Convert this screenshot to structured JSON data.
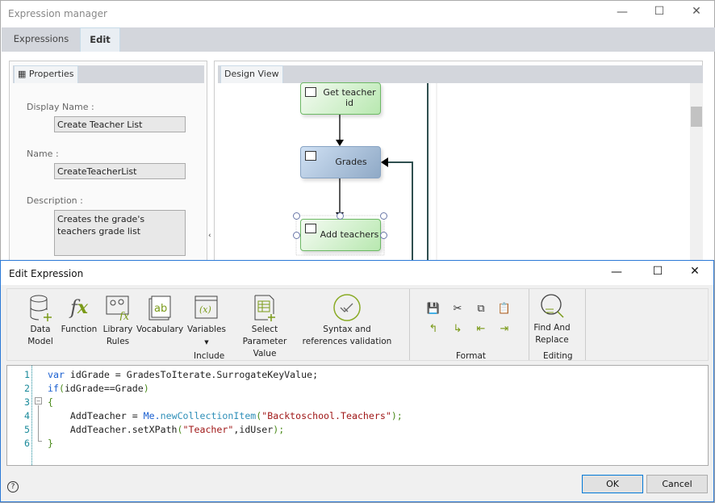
{
  "window": {
    "title": "Expression manager",
    "controls": [
      "minimize",
      "maximize",
      "close"
    ]
  },
  "tabs": [
    {
      "label": "Expressions",
      "active": false
    },
    {
      "label": "Edit",
      "active": true
    }
  ],
  "properties": {
    "tab": "Properties",
    "display_name_label": "Display Name :",
    "display_name": "Create Teacher List",
    "name_label": "Name :",
    "name": "CreateTeacherList",
    "description_label": "Description :",
    "description": "Creates the grade's teachers grade list"
  },
  "design": {
    "tab": "Design View",
    "nodes": [
      {
        "label": "Get teacher id",
        "type": "task",
        "color": "#b8e8b0"
      },
      {
        "label": "Grades",
        "type": "subprocess",
        "color": "#8fa9c6"
      },
      {
        "label": "Add teachers",
        "type": "task",
        "selected": true,
        "color": "#b8e8b0"
      }
    ]
  },
  "dialog": {
    "title": "Edit Expression",
    "include": {
      "label": "Include",
      "buttons": [
        {
          "label": "Data Model",
          "icon": "database-add-icon"
        },
        {
          "label": "Function",
          "icon": "function-icon"
        },
        {
          "label": "Library Rules",
          "icon": "library-rules-icon"
        },
        {
          "label": "Vocabulary",
          "icon": "vocabulary-icon"
        },
        {
          "label": "Variables",
          "icon": "variables-icon",
          "dropdown": true
        },
        {
          "label": "Select Parameter Value",
          "icon": "parameter-table-icon"
        },
        {
          "label": "Syntax and references validation",
          "icon": "validation-check-icon"
        }
      ]
    },
    "format": {
      "label": "Format",
      "buttons": [
        "save-icon",
        "cut-icon",
        "copy-icon",
        "paste-icon",
        "undo-icon",
        "redo-icon",
        "outdent-icon",
        "indent-icon"
      ]
    },
    "editing": {
      "label": "Editing",
      "find_replace": "Find And Replace"
    },
    "code": [
      [
        {
          "t": "var",
          "c": "kw"
        },
        {
          "t": " idGrade = GradesToIterate.SurrogateKeyValue;",
          "c": "id"
        }
      ],
      [
        {
          "t": "if",
          "c": "kw"
        },
        {
          "t": "(",
          "c": "pn"
        },
        {
          "t": "idGrade==Grade",
          "c": "id"
        },
        {
          "t": ")",
          "c": "pn"
        }
      ],
      [
        {
          "t": "{",
          "c": "pn"
        }
      ],
      [
        {
          "t": "    AddTeacher = ",
          "c": "id"
        },
        {
          "t": "Me.",
          "c": "kw"
        },
        {
          "t": "newCollectionItem",
          "c": "fn"
        },
        {
          "t": "(",
          "c": "pn"
        },
        {
          "t": "\"Backtoschool.Teachers\"",
          "c": "str"
        },
        {
          "t": ");",
          "c": "pn"
        }
      ],
      [
        {
          "t": "    AddTeacher.setXPath",
          "c": "id"
        },
        {
          "t": "(",
          "c": "pn"
        },
        {
          "t": "\"Teacher\"",
          "c": "str"
        },
        {
          "t": ",idUser",
          "c": "id"
        },
        {
          "t": ");",
          "c": "pn"
        }
      ],
      [
        {
          "t": "}",
          "c": "pn"
        }
      ]
    ],
    "ok": "OK",
    "cancel": "Cancel"
  }
}
